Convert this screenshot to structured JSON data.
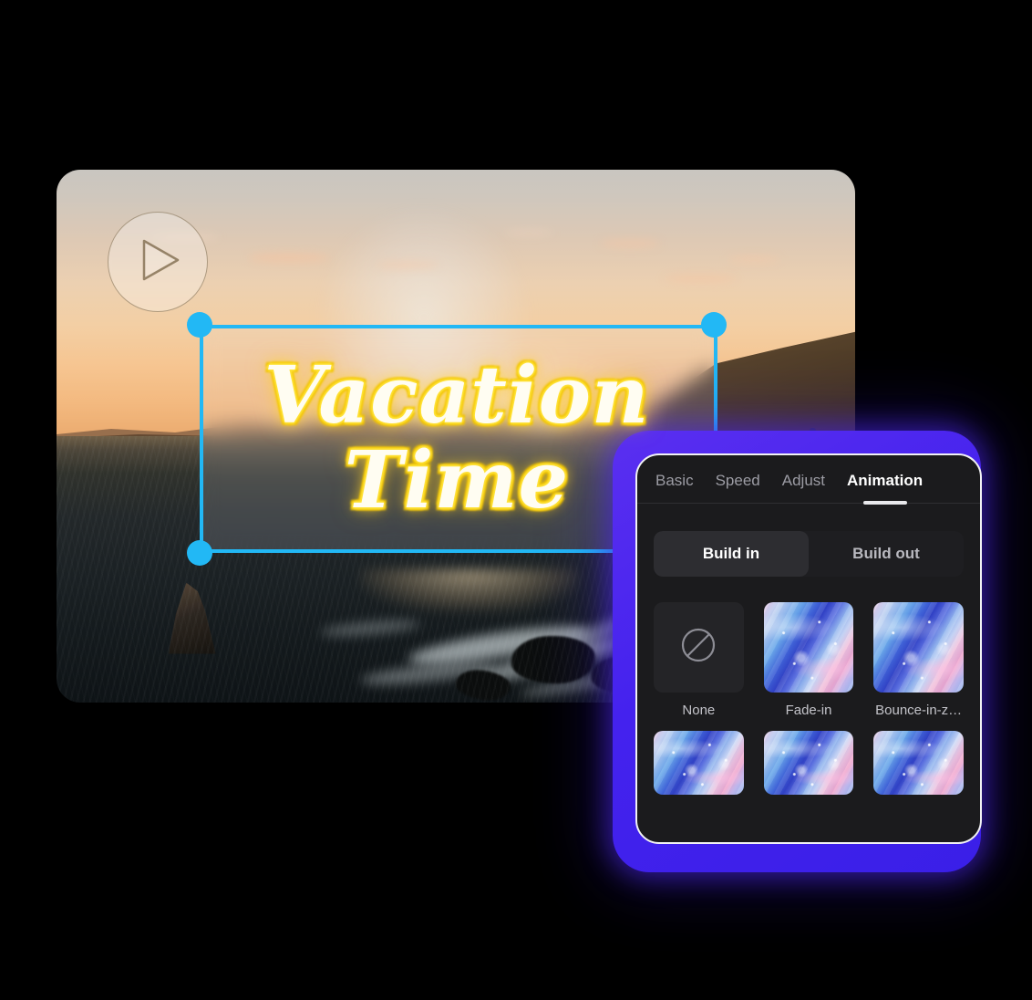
{
  "video": {
    "play_icon": "play-icon",
    "text_overlay": {
      "line1": "Vacation",
      "line2": "Time"
    },
    "selection_handle_color": "#22b8f5"
  },
  "panel": {
    "frame_color": "#4422ee",
    "tabs": [
      {
        "label": "Basic",
        "active": false
      },
      {
        "label": "Speed",
        "active": false
      },
      {
        "label": "Adjust",
        "active": false
      },
      {
        "label": "Animation",
        "active": true
      }
    ],
    "segmented": [
      {
        "label": "Build in",
        "active": true
      },
      {
        "label": "Build out",
        "active": false
      }
    ],
    "presets_row1": [
      {
        "label": "None",
        "icon": "no-entry-icon",
        "type": "none"
      },
      {
        "label": "Fade-in",
        "type": "art"
      },
      {
        "label": "Bounce-in-z…",
        "type": "art"
      }
    ],
    "presets_row2": [
      {
        "label": "",
        "type": "art"
      },
      {
        "label": "",
        "type": "art"
      },
      {
        "label": "",
        "type": "art"
      }
    ]
  }
}
